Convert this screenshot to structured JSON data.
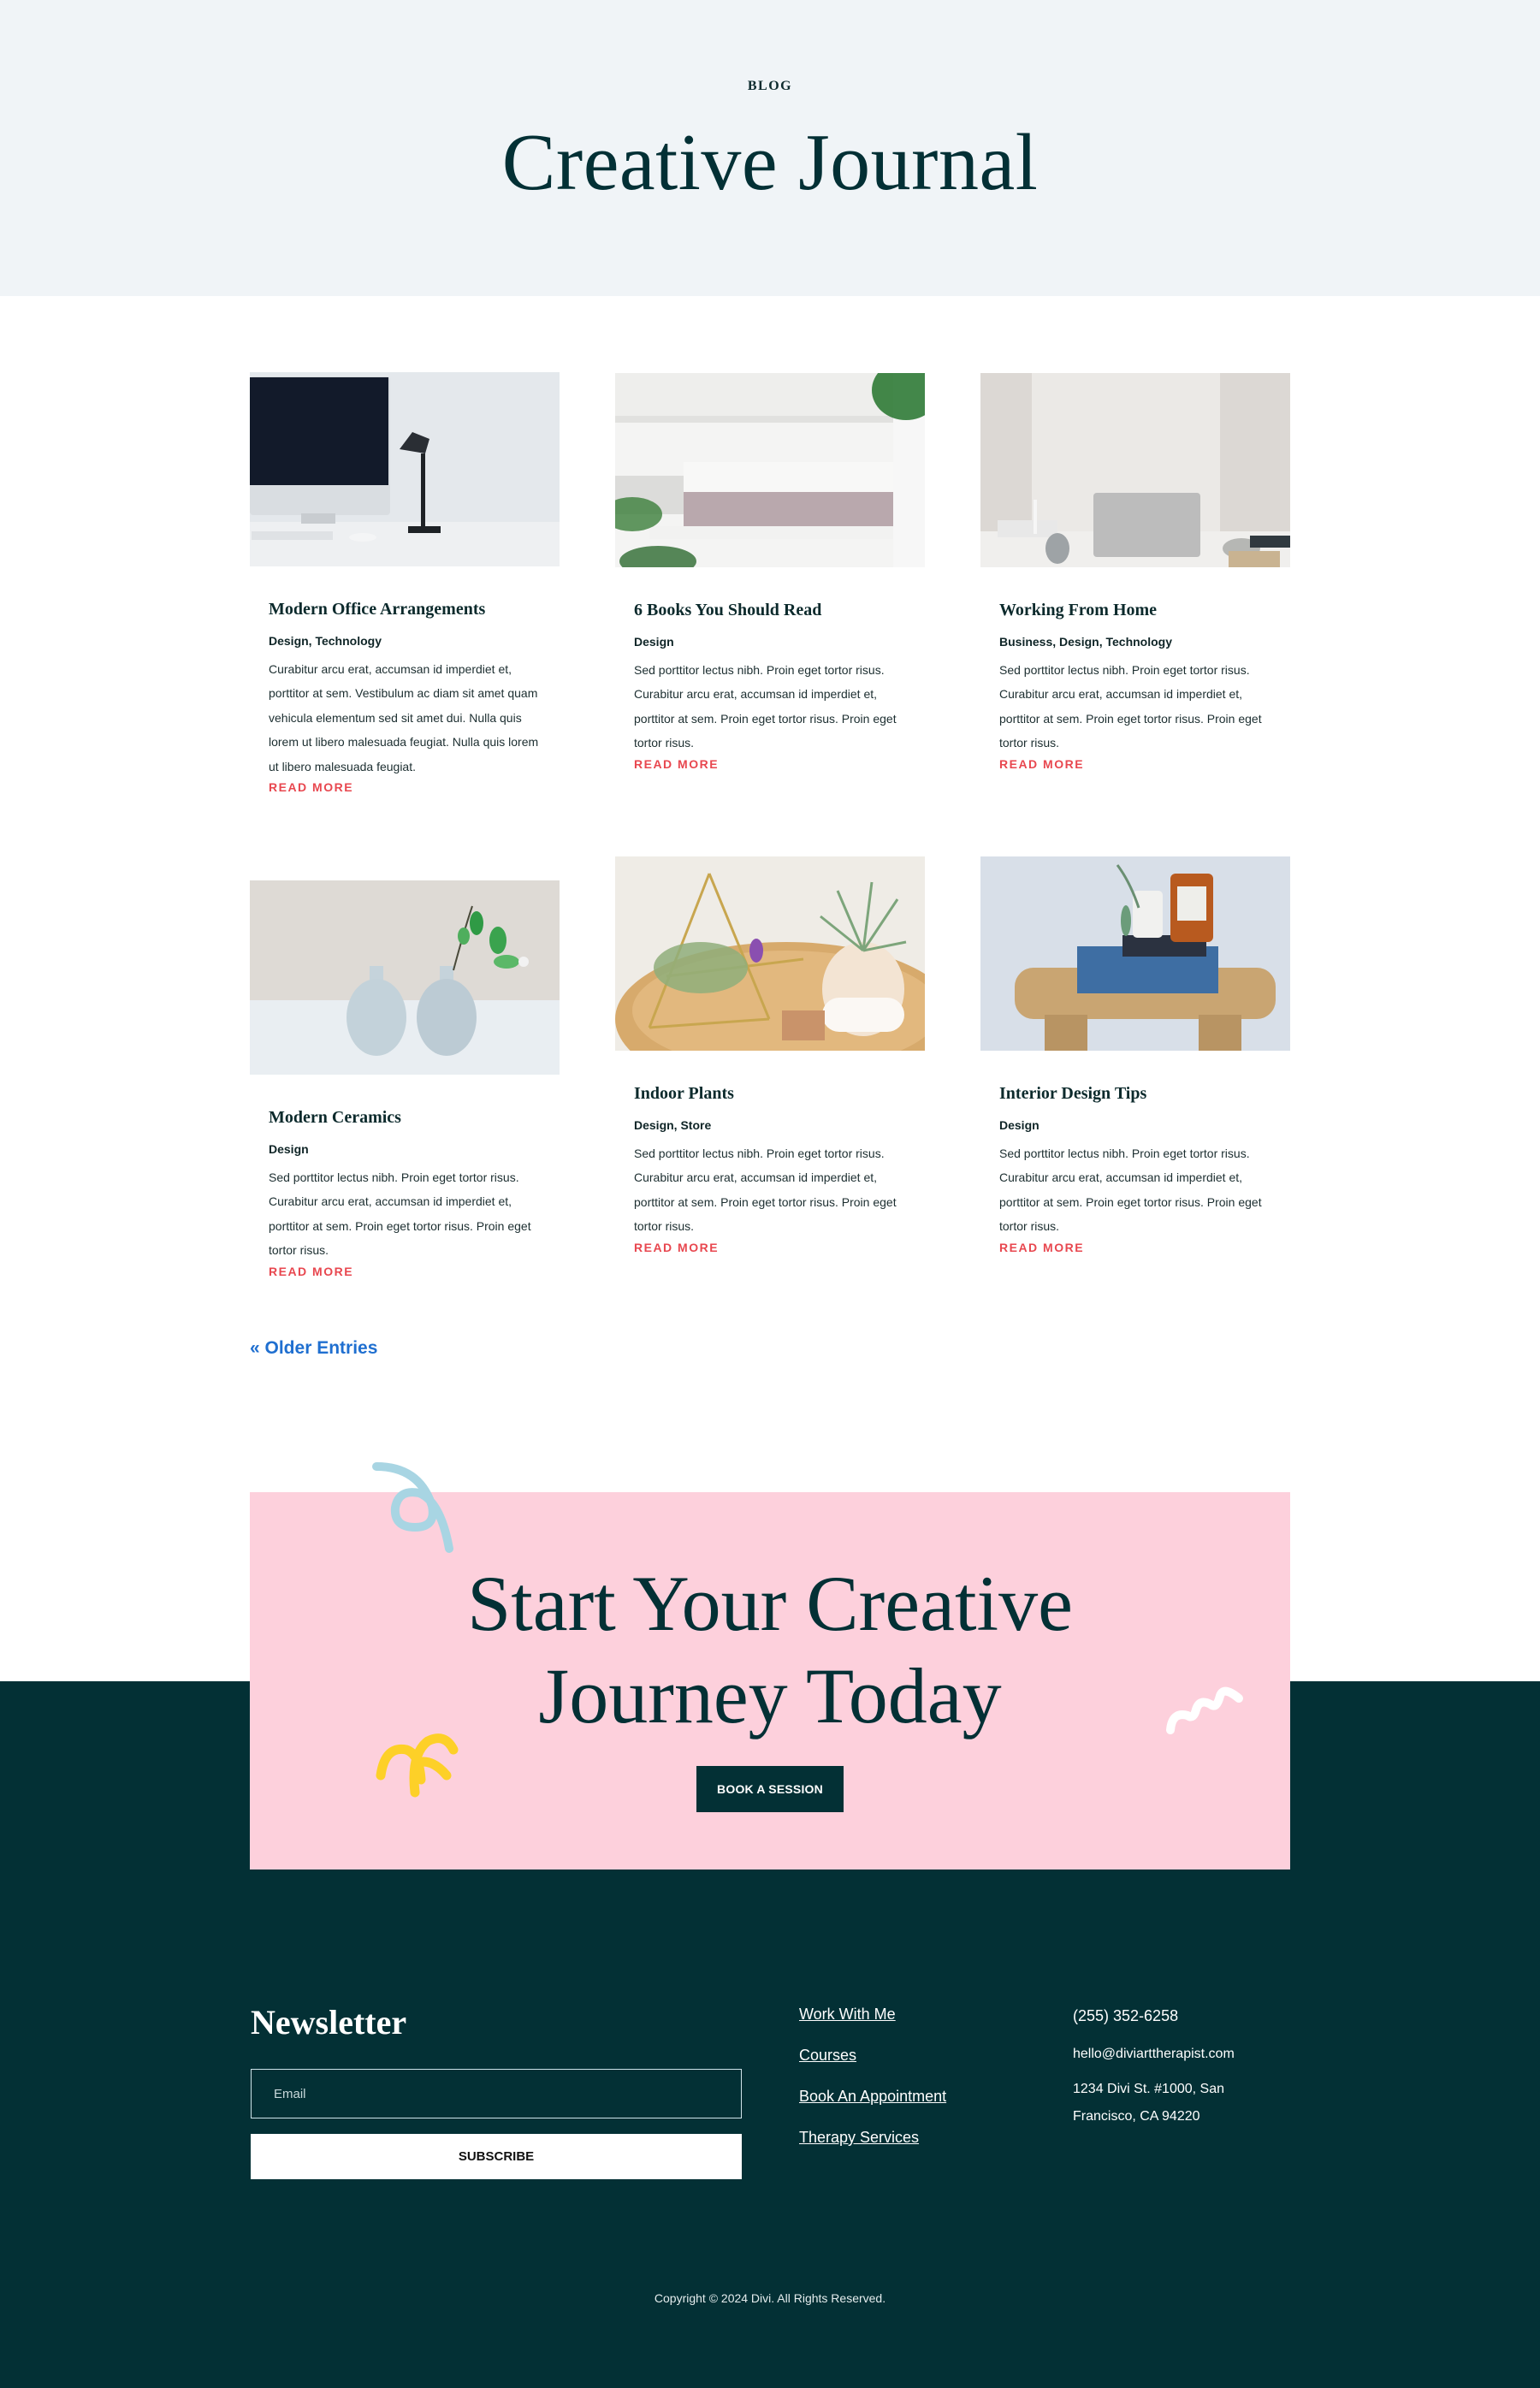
{
  "hero": {
    "eyebrow": "BLOG",
    "title": "Creative Journal"
  },
  "posts": [
    {
      "title": "Modern Office Arrangements",
      "categories": "Design, Technology",
      "excerpt": "Curabitur arcu erat, accumsan id imperdiet et, porttitor at sem. Vestibulum ac diam sit amet quam vehicula elementum sed sit amet dui. Nulla quis lorem ut libero malesuada feugiat. Nulla quis lorem ut libero malesuada feugiat.",
      "read_more": "READ MORE",
      "image": "desk-with-monitor-and-lamp"
    },
    {
      "title": "6 Books You Should Read",
      "categories": "Design",
      "excerpt": "Sed porttitor lectus nibh. Proin eget tortor risus. Curabitur arcu erat, accumsan id imperdiet et, porttitor at sem. Proin eget tortor risus. Proin eget tortor risus.",
      "read_more": "READ MORE",
      "image": "books-on-white-shelf"
    },
    {
      "title": "Working From Home",
      "categories": "Business, Design, Technology",
      "excerpt": "Sed porttitor lectus nibh. Proin eget tortor risus. Curabitur arcu erat, accumsan id imperdiet et, porttitor at sem. Proin eget tortor risus. Proin eget tortor risus.",
      "read_more": "READ MORE",
      "image": "laptop-on-table"
    },
    {
      "title": "Modern Ceramics",
      "categories": "Design",
      "excerpt": "Sed porttitor lectus nibh. Proin eget tortor risus. Curabitur arcu erat, accumsan id imperdiet et, porttitor at sem. Proin eget tortor risus. Proin eget tortor risus.",
      "read_more": "READ MORE",
      "image": "ceramic-vases"
    },
    {
      "title": "Indoor Plants",
      "categories": "Design, Store",
      "excerpt": "Sed porttitor lectus nibh. Proin eget tortor risus. Curabitur arcu erat, accumsan id imperdiet et, porttitor at sem. Proin eget tortor risus. Proin eget tortor risus.",
      "read_more": "READ MORE",
      "image": "air-plants-on-tray"
    },
    {
      "title": "Interior Design Tips",
      "categories": "Design",
      "excerpt": "Sed porttitor lectus nibh. Proin eget tortor risus. Curabitur arcu erat, accumsan id imperdiet et, porttitor at sem. Proin eget tortor risus. Proin eget tortor risus.",
      "read_more": "READ MORE",
      "image": "books-on-wooden-stool"
    }
  ],
  "pagination": {
    "older_entries": "« Older Entries"
  },
  "cta": {
    "title_line1": "Start Your Creative",
    "title_line2": "Journey Today",
    "button": "BOOK A SESSION"
  },
  "footer": {
    "newsletter_title": "Newsletter",
    "email_placeholder": "Email",
    "subscribe": "SUBSCRIBE",
    "links": [
      "Work With Me",
      "Courses",
      "Book An Appointment",
      "Therapy Services"
    ],
    "phone": "(255) 352-6258",
    "email": "hello@diviarttherapist.com",
    "address": "1234 Divi St. #1000, San Francisco, CA 94220",
    "copyright": "Copyright © 2024 Divi. All Rights Reserved."
  },
  "colors": {
    "dark_teal": "#033035",
    "pink": "#fdd0dc",
    "accent_red": "#e8474f",
    "link_blue": "#1f6fd0",
    "header_bg": "#f0f4f7"
  }
}
